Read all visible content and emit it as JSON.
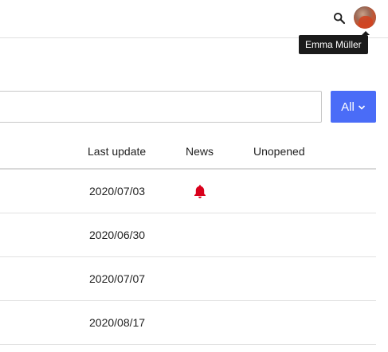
{
  "header": {
    "search_icon": "search-icon",
    "user": {
      "name": "Emma Müller"
    }
  },
  "search": {
    "value": "",
    "placeholder": ""
  },
  "filter": {
    "label": "All",
    "icon": "chevron-down-icon"
  },
  "table": {
    "columns": [
      "Last update",
      "News",
      "Unopened"
    ],
    "rows": [
      {
        "last_update": "2020/07/03",
        "news": true,
        "unopened": ""
      },
      {
        "last_update": "2020/06/30",
        "news": false,
        "unopened": ""
      },
      {
        "last_update": "2020/07/07",
        "news": false,
        "unopened": ""
      },
      {
        "last_update": "2020/08/17",
        "news": false,
        "unopened": ""
      }
    ]
  },
  "colors": {
    "accent": "#4a6cf7",
    "alert": "#d9001b",
    "tooltip_bg": "#1b1b1b"
  }
}
